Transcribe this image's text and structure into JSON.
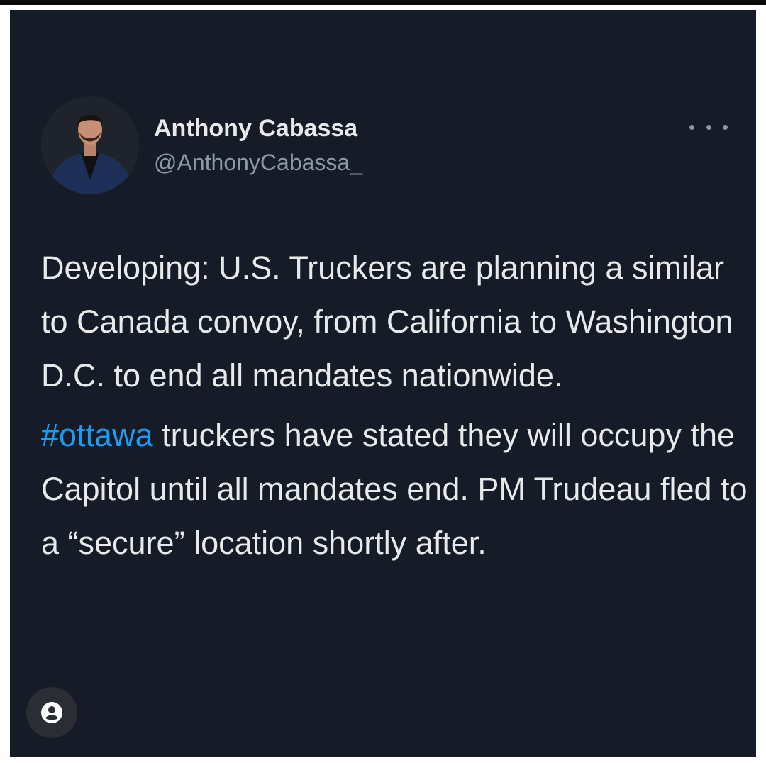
{
  "tweet": {
    "author_name": "Anthony Cabassa",
    "author_handle": "@AnthonyCabassa_",
    "paragraph1": "Developing: U.S. Truckers are planning a similar to Canada convoy, from California to Washington D.C. to end all mandates nationwide.",
    "hashtag": "#ottawa",
    "paragraph2_rest": " truckers have stated they will occupy the Capitol until all mandates end. PM Trudeau fled to a “secure” location shortly after."
  },
  "icons": {
    "more": "more-dots-icon",
    "profile": "user-circle-icon"
  },
  "colors": {
    "background": "#151c28",
    "text": "#e7e9ea",
    "secondary_text": "#8b98a5",
    "link": "#1d9bf0"
  }
}
